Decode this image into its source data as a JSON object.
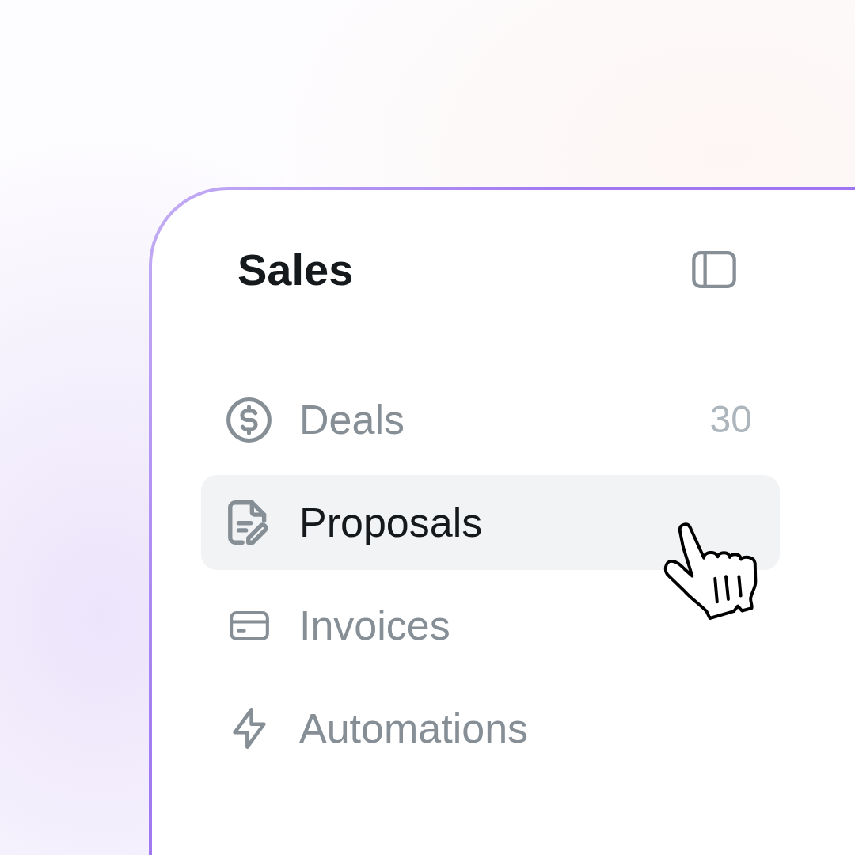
{
  "sidebar": {
    "title": "Sales",
    "items": [
      {
        "label": "Deals",
        "count": "30",
        "selected": false
      },
      {
        "label": "Proposals",
        "selected": true
      },
      {
        "label": "Invoices",
        "selected": false
      },
      {
        "label": "Automations",
        "selected": false
      }
    ]
  }
}
